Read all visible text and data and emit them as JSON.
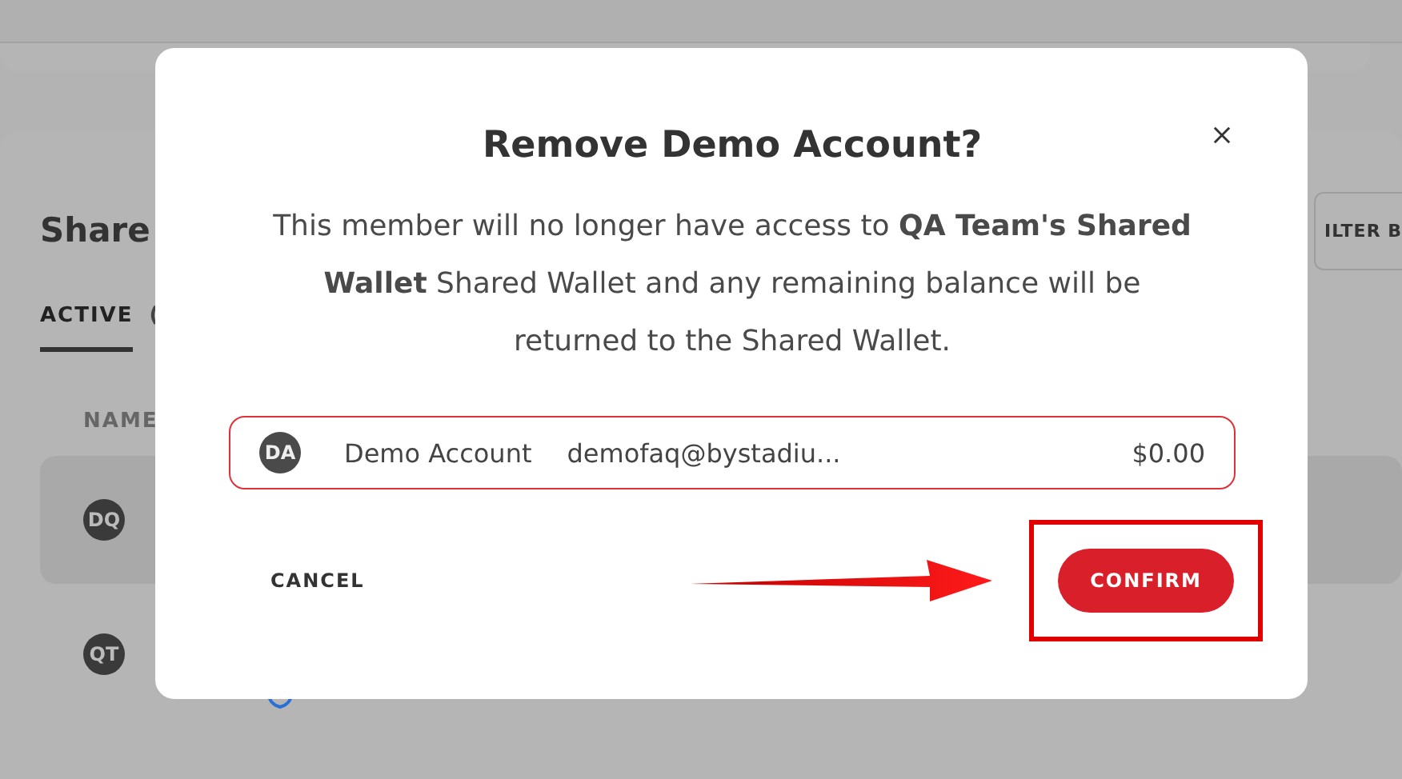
{
  "page": {
    "heading": "Share",
    "tabs": [
      {
        "label": "ACTIVE",
        "selected": true
      },
      {
        "label": "(",
        "selected": false
      }
    ],
    "filter_button": "ILTER B",
    "column_header": "NAME",
    "rows": [
      {
        "initials": "DQ",
        "selected": true
      },
      {
        "initials": "QT",
        "selected": false
      }
    ]
  },
  "dialog": {
    "title": "Remove Demo Account?",
    "message": "This member will no longer have access to **QA Team's Shared Wallet** Shared Wallet and any remaining balance will be returned to the Shared Wallet.",
    "member": {
      "initials": "DA",
      "name": "Demo Account",
      "email": "demofaq@bystadiu...",
      "balance": "$0.00"
    },
    "buttons": [
      {
        "label": "CANCEL",
        "kind": "text"
      },
      {
        "label": "CONFIRM",
        "kind": "primary",
        "highlighted": true
      }
    ]
  }
}
